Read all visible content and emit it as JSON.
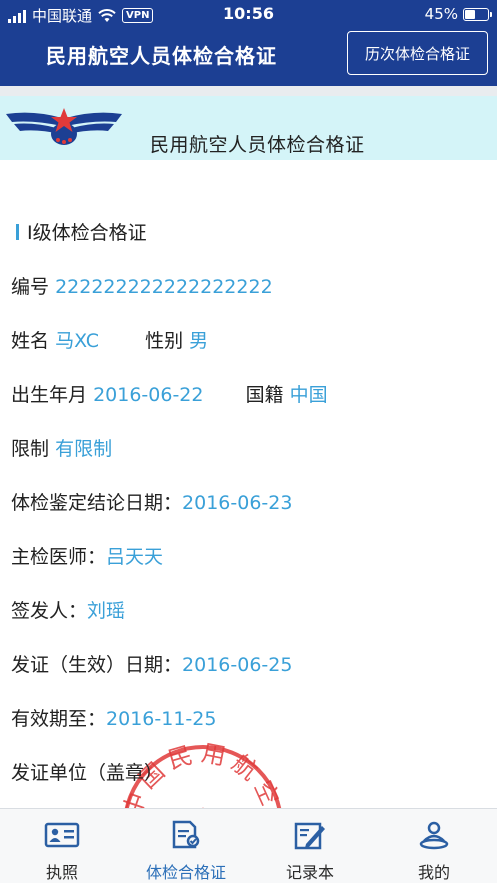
{
  "status_bar": {
    "carrier": "中国联通",
    "vpn": "VPN",
    "time": "10:56",
    "battery_percent": "45%",
    "battery_level": 0.45
  },
  "nav": {
    "title": "民用航空人员体检合格证",
    "history_button": "历次体检合格证"
  },
  "certificate": {
    "banner_title": "民用航空人员体检合格证",
    "class_title": "Ⅰ级体检合格证",
    "number_label": "编号",
    "number": "222222222222222222",
    "name_label": "姓名",
    "name": "马XC",
    "gender_label": "性别",
    "gender": "男",
    "birth_label": "出生年月",
    "birth": "2016-06-22",
    "nationality_label": "国籍",
    "nationality": "中国",
    "restriction_label": "限制",
    "restriction": "有限制",
    "exam_date_label": "体检鉴定结论日期：",
    "exam_date": "2016-06-23",
    "doctor_label": "主检医师：",
    "doctor": "吕天天",
    "issuer_label": "签发人：",
    "issuer": "刘瑶",
    "issue_date_label": "发证（生效）日期：",
    "issue_date": "2016-06-25",
    "valid_until_label": "有效期至：",
    "valid_until": "2016-11-25",
    "issuing_unit_label": "发证单位（盖章）",
    "seal_text": "中国民用航空局"
  },
  "tabs": [
    {
      "label": "执照",
      "icon": "id-card-icon",
      "active": false
    },
    {
      "label": "体检合格证",
      "icon": "medical-certificate-icon",
      "active": true
    },
    {
      "label": "记录本",
      "icon": "logbook-icon",
      "active": false
    },
    {
      "label": "我的",
      "icon": "user-icon",
      "active": false
    }
  ],
  "colors": {
    "header_bg": "#1c3f93",
    "banner_bg": "#d4f4f8",
    "value_text": "#3aa0d8",
    "active_tab": "#2b6fb8",
    "seal_red": "#e03a3a"
  }
}
